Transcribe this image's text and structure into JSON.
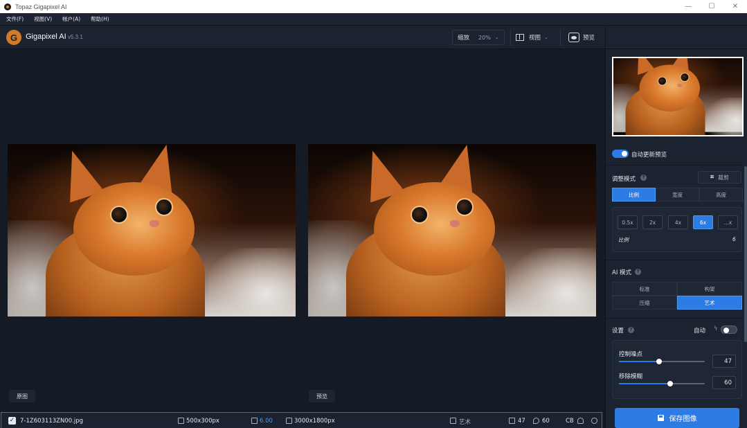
{
  "window": {
    "title": "Topaz Gigapixel AI",
    "controls": {
      "minimize": "—",
      "maximize": "☐",
      "close": "✕"
    }
  },
  "menu": [
    "文件(F)",
    "视图(V)",
    "帐户(A)",
    "帮助(H)"
  ],
  "header": {
    "logo_letter": "G",
    "app_name": "Gigapixel AI",
    "version": "v5.3.1",
    "zoom_label": "缩放",
    "zoom_value": "20%",
    "view_label": "视图",
    "preview_label": "预览"
  },
  "main": {
    "original_label": "原图",
    "preview_label": "预览"
  },
  "file_row": {
    "checked": true,
    "check_glyph": "✓",
    "filename": "7-1Z603113ZN00.jpg",
    "input_size": "500x300px",
    "scale": "6.00",
    "output_size": "3000x1800px",
    "mode": "艺术",
    "noise": "47",
    "blur": "60",
    "color": "CB"
  },
  "panel": {
    "auto_update_label": "自动更新预览",
    "auto_update_on": true,
    "adjust_mode": {
      "title": "调整模式",
      "crop_label": "裁剪",
      "tabs": [
        "比例",
        "宽度",
        "高度"
      ],
      "active_tab": 0
    },
    "scale": {
      "options": [
        "0.5x",
        "2x",
        "4x",
        "6x",
        "...x"
      ],
      "active_index": 3,
      "label": "比例",
      "value": "6"
    },
    "ai_mode": {
      "title": "AI 模式",
      "options": [
        "标准",
        "构架",
        "压缩",
        "艺术"
      ],
      "active_index": 3
    },
    "settings": {
      "title": "设置",
      "auto_label": "自动",
      "auto_on": false,
      "sliders": [
        {
          "label": "控制噪点",
          "value": "47",
          "level": 0.47
        },
        {
          "label": "移除模糊",
          "value": "60",
          "level": 0.6
        }
      ]
    },
    "save_label": "保存图像"
  },
  "colors": {
    "accent": "#2d7be5",
    "bg": "#151b25",
    "panel": "#1b2230"
  }
}
